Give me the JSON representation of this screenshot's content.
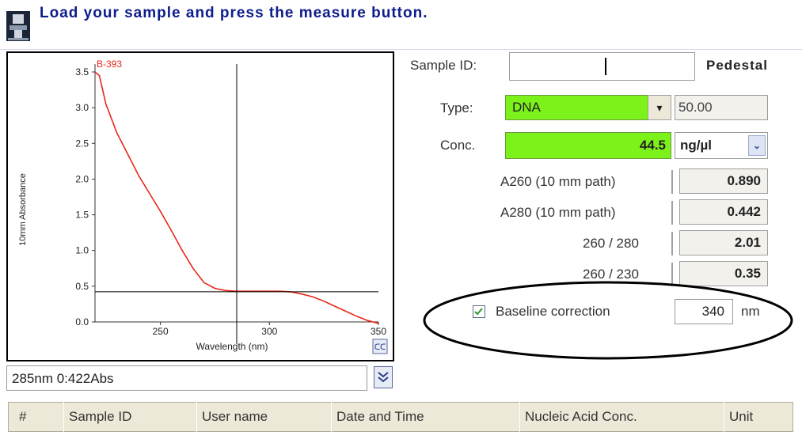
{
  "header": {
    "message": "Load your sample and press the measure button."
  },
  "plot": {
    "ylabel": "10mm Absorbance",
    "xlabel": "Wavelength (nm)",
    "sample_label": "B-393",
    "y_ticks": [
      "3.5",
      "3.0",
      "2.5",
      "2.0",
      "1.5",
      "1.0",
      "0.5",
      "0.0"
    ],
    "x_ticks": [
      "250",
      "300",
      "350"
    ],
    "cursor_readout": "285nm 0:422Abs",
    "curve_color": "#e8261a"
  },
  "chart_data": {
    "type": "line",
    "xlabel": "Wavelength (nm)",
    "ylabel": "10mm Absorbance",
    "xlim": [
      220,
      350
    ],
    "ylim": [
      0,
      3.5
    ],
    "series": [
      {
        "name": "B-393",
        "x": [
          220,
          222,
          225,
          230,
          235,
          240,
          245,
          250,
          255,
          260,
          265,
          270,
          275,
          280,
          285,
          290,
          295,
          300,
          305,
          310,
          315,
          320,
          325,
          330,
          335,
          340,
          345,
          350
        ],
        "y": [
          3.5,
          3.45,
          3.05,
          2.65,
          2.35,
          2.05,
          1.8,
          1.55,
          1.28,
          1.0,
          0.75,
          0.55,
          0.47,
          0.44,
          0.43,
          0.43,
          0.43,
          0.43,
          0.43,
          0.42,
          0.39,
          0.35,
          0.29,
          0.22,
          0.15,
          0.08,
          0.02,
          -0.02
        ]
      }
    ],
    "crosshair": {
      "x": 285,
      "y": 0.422
    }
  },
  "panel": {
    "sample_id_label": "Sample ID:",
    "sample_id_value": "",
    "mode": "Pedestal",
    "type_label": "Type:",
    "type_value": "DNA",
    "type_factor": "50.00",
    "conc_label": "Conc.",
    "conc_value": "44.5",
    "conc_unit": "ng/µl",
    "a260_label": "A260 (10 mm path)",
    "a260_value": "0.890",
    "a280_label": "A280 (10 mm path)",
    "a280_value": "0.442",
    "ratio_260_280_label": "260 / 280",
    "ratio_260_280_value": "2.01",
    "ratio_260_230_label": "260 / 230",
    "ratio_260_230_value": "0.35",
    "baseline_label": "Baseline correction",
    "baseline_checked": true,
    "baseline_value": "340",
    "baseline_unit": "nm",
    "accent_color": "#7df21a"
  },
  "table": {
    "columns": [
      "#",
      "Sample ID",
      "User name",
      "Date and Time",
      "Nucleic Acid Conc.",
      "Unit"
    ]
  }
}
